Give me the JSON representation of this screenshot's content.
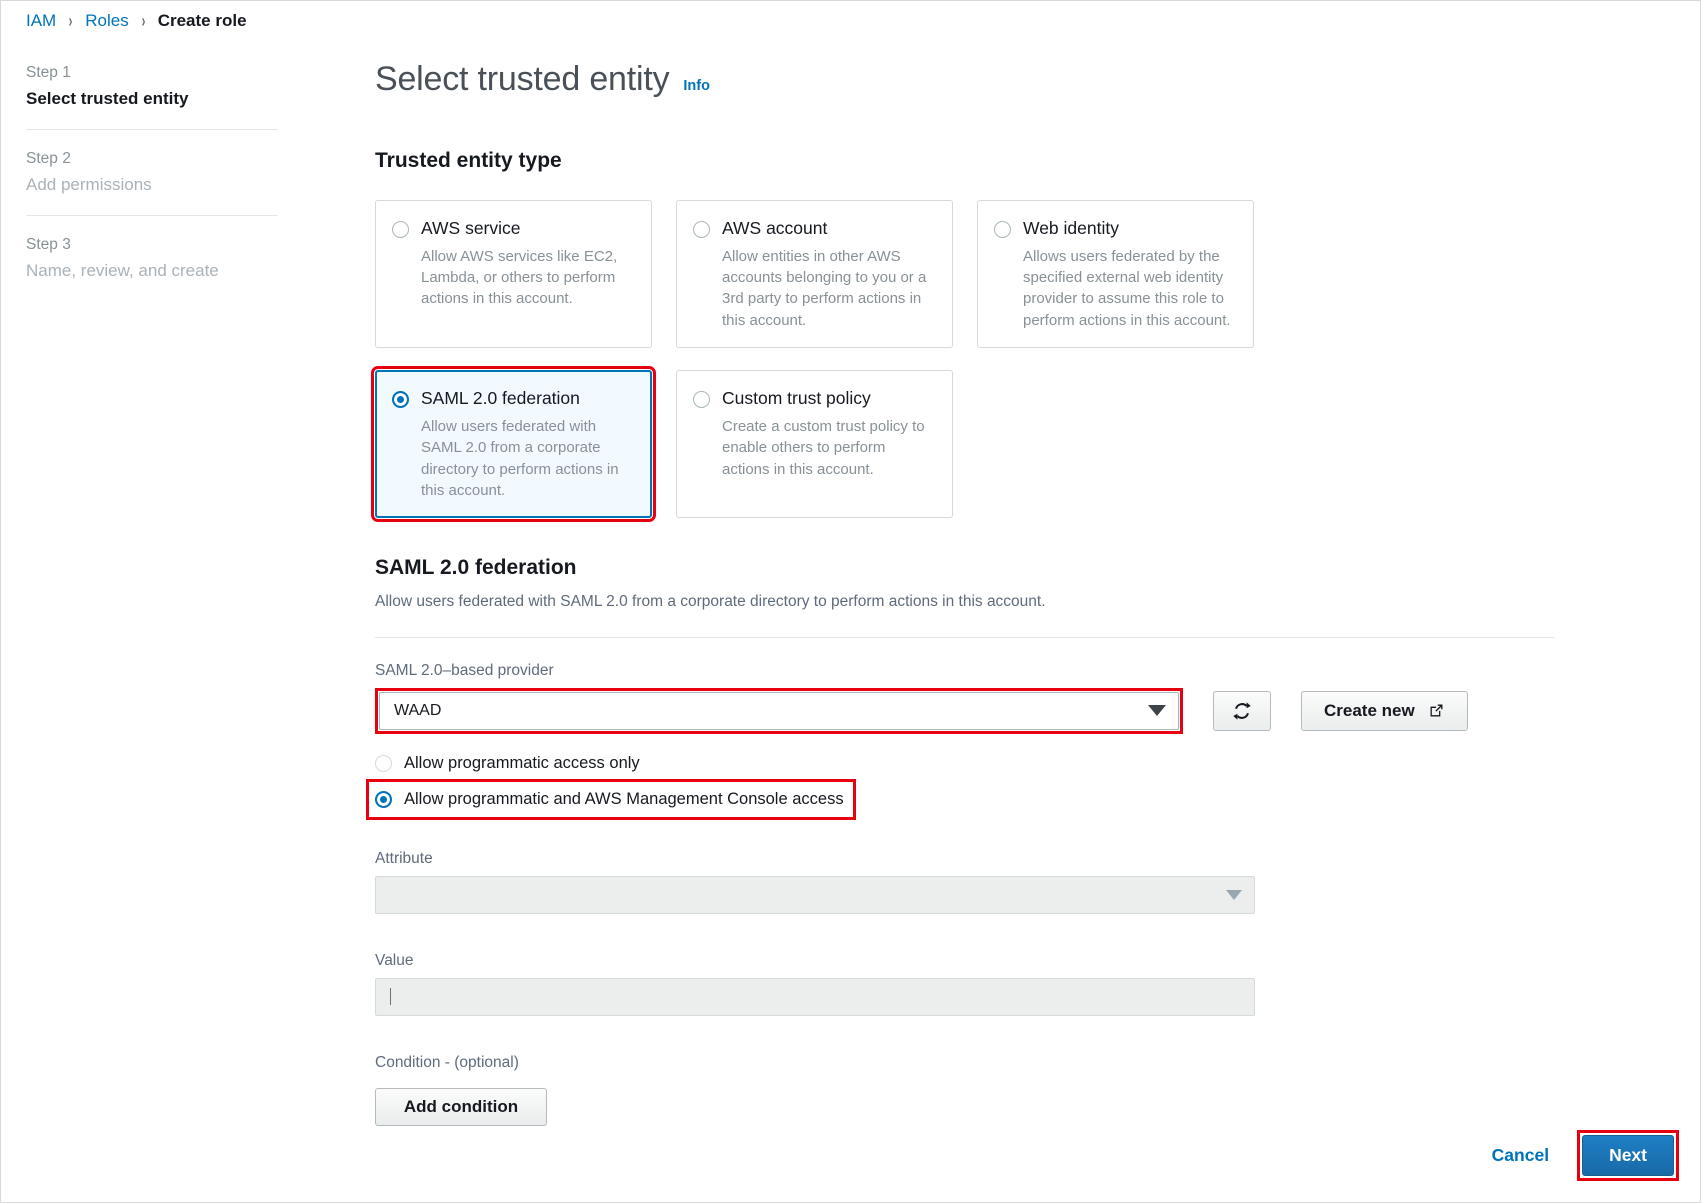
{
  "breadcrumb": {
    "items": [
      {
        "label": "IAM",
        "current": false
      },
      {
        "label": "Roles",
        "current": false
      },
      {
        "label": "Create role",
        "current": true
      }
    ],
    "separator": "›"
  },
  "steps": [
    {
      "num": "Step 1",
      "name": "Select trusted entity",
      "active": true
    },
    {
      "num": "Step 2",
      "name": "Add permissions",
      "active": false
    },
    {
      "num": "Step 3",
      "name": "Name, review, and create",
      "active": false
    }
  ],
  "page": {
    "title": "Select trusted entity",
    "info_label": "Info",
    "trusted_entity_type_heading": "Trusted entity type"
  },
  "entity_cards": [
    {
      "title": "AWS service",
      "desc": "Allow AWS services like EC2, Lambda, or others to perform actions in this account.",
      "selected": false,
      "annotated": false
    },
    {
      "title": "AWS account",
      "desc": "Allow entities in other AWS accounts belonging to you or a 3rd party to perform actions in this account.",
      "selected": false,
      "annotated": false
    },
    {
      "title": "Web identity",
      "desc": "Allows users federated by the specified external web identity provider to assume this role to perform actions in this account.",
      "selected": false,
      "annotated": false
    },
    {
      "title": "SAML 2.0 federation",
      "desc": "Allow users federated with SAML 2.0 from a corporate directory to perform actions in this account.",
      "selected": true,
      "annotated": true
    },
    {
      "title": "Custom trust policy",
      "desc": "Create a custom trust policy to enable others to perform actions in this account.",
      "selected": false,
      "annotated": false
    }
  ],
  "saml_section": {
    "heading": "SAML 2.0 federation",
    "description": "Allow users federated with SAML 2.0 from a corporate directory to perform actions in this account.",
    "provider_label": "SAML 2.0–based provider",
    "provider_value": "WAAD",
    "refresh_icon": "refresh-icon",
    "create_new_label": "Create new",
    "external_link_icon": "external-link-icon",
    "access_options": [
      {
        "label": "Allow programmatic access only",
        "selected": false,
        "annotated": false
      },
      {
        "label": "Allow programmatic and AWS Management Console access",
        "selected": true,
        "annotated": true
      }
    ],
    "attribute_label": "Attribute",
    "attribute_value": "",
    "value_label": "Value",
    "value_text": "",
    "condition_label": "Condition - (optional)",
    "add_condition_label": "Add condition"
  },
  "footer": {
    "cancel_label": "Cancel",
    "next_label": "Next",
    "next_annotated": true
  },
  "colors": {
    "link_blue": "#0073bb",
    "annotation_red": "#e7000f",
    "selected_card_bg": "#f1faff",
    "primary_button": "#1b6fae"
  }
}
